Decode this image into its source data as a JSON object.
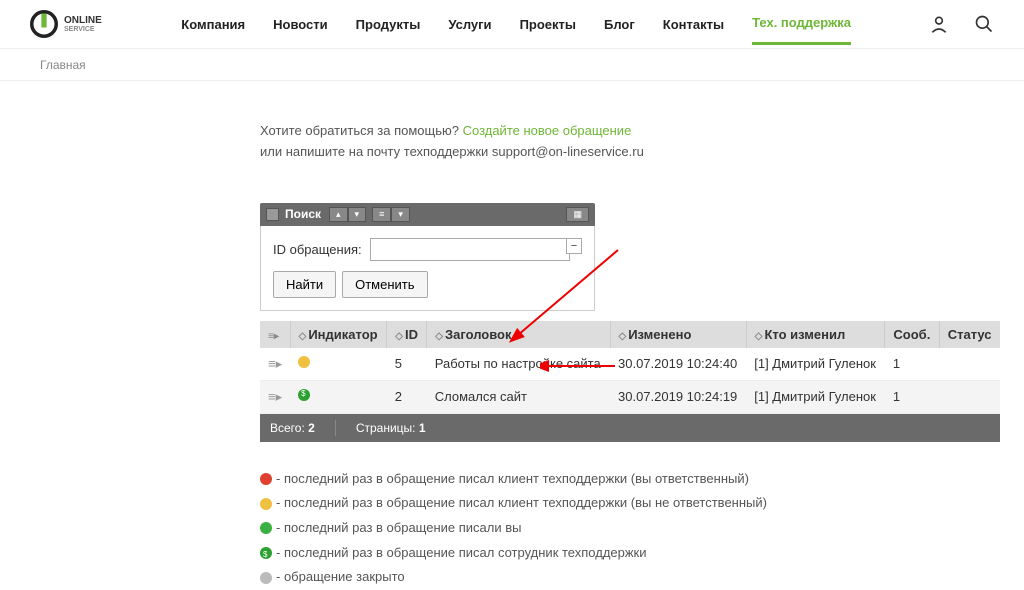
{
  "logo": {
    "name": "ONLINE",
    "sub": "SERVICE"
  },
  "nav": {
    "items": [
      "Компания",
      "Новости",
      "Продукты",
      "Услуги",
      "Проекты",
      "Блог",
      "Контакты",
      "Тех. поддержка"
    ],
    "active_idx": 7
  },
  "breadcrumb": "Главная",
  "intro": {
    "question": "Хотите обратиться за помощью? ",
    "link": "Создайте новое обращение",
    "line2": "или напишите на почту техподдержки support@on-lineservice.ru"
  },
  "toolbar": {
    "search_label": "Поиск"
  },
  "search": {
    "field_label": "ID обращения:",
    "value": "",
    "find": "Найти",
    "cancel": "Отменить"
  },
  "table": {
    "headers": [
      "",
      "Индикатор",
      "ID",
      "Заголовок",
      "Изменено",
      "Кто изменил",
      "Сооб.",
      "Статус"
    ],
    "rows": [
      {
        "indicator": "yellow",
        "id": "5",
        "title": "Работы по настройке сайта",
        "changed": "30.07.2019 10:24:40",
        "by": "[1] Дмитрий Гуленок",
        "msg": "1",
        "status": ""
      },
      {
        "indicator": "green-bold",
        "id": "2",
        "title": "Сломался сайт",
        "changed": "30.07.2019 10:24:19",
        "by": "[1] Дмитрий Гуленок",
        "msg": "1",
        "status": ""
      }
    ]
  },
  "footer": {
    "total_label": "Всего: ",
    "total": "2",
    "pages_label": "Страницы: ",
    "page": "1"
  },
  "legend": {
    "red": "- последний раз в обращение писал клиент техподдержки (вы ответственный)",
    "yellow": "- последний раз в обращение писал клиент техподдержки (вы не ответственный)",
    "green": "- последний раз в обращение писали вы",
    "green_bold": "- последний раз в обращение писал сотрудник техподдержки",
    "grey": "- обращение закрыто"
  }
}
